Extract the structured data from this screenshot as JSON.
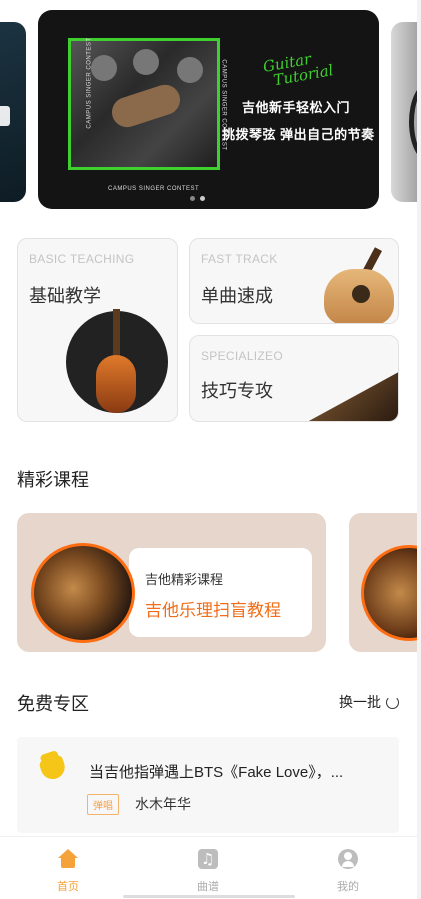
{
  "banner": {
    "logo_line1": "Guitar",
    "logo_line2": "Tutorial",
    "line1": "吉他新手轻松入门",
    "line2": "挑拨琴弦 弹出自己的节奏",
    "contest_text": "CAMPUS SINGER CONTEST",
    "pages": 2,
    "active_page": 2
  },
  "categories": [
    {
      "en": "BASIC TEACHING",
      "zh": "基础教学"
    },
    {
      "en": "FAST TRACK",
      "zh": "单曲速成"
    },
    {
      "en": "SPECIALIZEO",
      "zh": "技巧专攻"
    }
  ],
  "courses_section": {
    "title": "精彩课程",
    "cards": [
      {
        "subtitle": "吉他精彩课程",
        "title": "吉他乐理扫盲教程"
      }
    ]
  },
  "free_section": {
    "title": "免费专区",
    "refresh_label": "换一批",
    "items": [
      {
        "title": "当吉他指弹遇上BTS《Fake Love》，...",
        "tag": "弹唱",
        "author": "水木年华"
      }
    ]
  },
  "tabbar": {
    "tabs": [
      {
        "label": "首页",
        "icon": "home-icon",
        "active": true
      },
      {
        "label": "曲谱",
        "icon": "music-score-icon",
        "active": false
      },
      {
        "label": "我的",
        "icon": "user-icon",
        "active": false
      }
    ]
  },
  "colors": {
    "accent": "#f5a23a",
    "course_title": "#f26d17",
    "banner_green": "#3fcf2f",
    "course_card_bg": "#e6d6cb"
  }
}
